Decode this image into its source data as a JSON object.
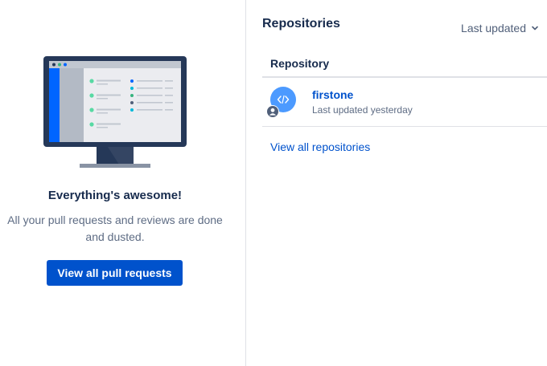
{
  "left_panel": {
    "illustration_icon": "monitor-illustration",
    "empty_title": "Everything's awesome!",
    "empty_description": "All your pull requests and reviews are done and dusted.",
    "button_label": "View all pull requests"
  },
  "right_panel": {
    "title": "Repositories",
    "sort_label": "Last updated",
    "sort_icon": "chevron-down-icon",
    "column_header": "Repository",
    "repos": [
      {
        "name": "firstone",
        "meta": "Last updated yesterday",
        "icon": "code-icon",
        "owner_icon": "user-icon"
      }
    ],
    "view_all_label": "View all repositories"
  },
  "colors": {
    "primary": "#0052cc",
    "link": "#0052cc",
    "text": "#172b4d",
    "subtle_text": "#5e6c84",
    "border": "#dfe1e6",
    "avatar": "#4c9aff"
  }
}
